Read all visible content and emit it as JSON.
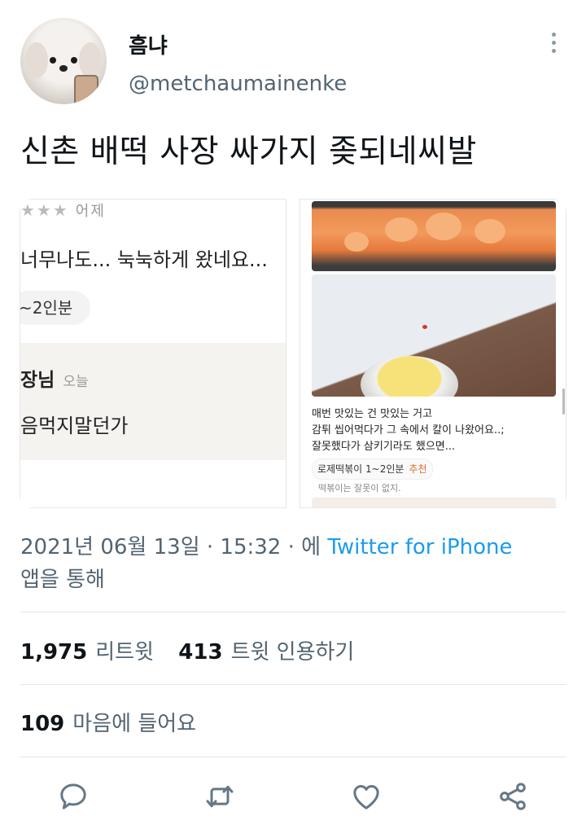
{
  "author": {
    "display_name": "흠냐",
    "handle": "@metchaumainenke"
  },
  "tweet": {
    "text": "신촌 배떡 사장 싸가지 좆되네씨발"
  },
  "media": {
    "left_image": {
      "rating_tail": "어제",
      "review_text": "너무나도... 눅눅하게 왔네요...",
      "pill": "~2인분",
      "owner_label": "장님",
      "owner_time": "오늘",
      "owner_reply": "음먹지말던가"
    },
    "right_image": {
      "line1": "매번 맛있는 건 맛있는 거고",
      "line2": "감튀 씹어먹다가 그 속에서 칼이 나왔어요..;",
      "line3": "잘못했다가 삼키기라도 했으면...",
      "tag": "로제떡볶이 1~2인분",
      "tag_badge": "추천",
      "sub": "떡볶이는 잘못이 없지."
    }
  },
  "meta": {
    "datetime": "2021년 06월 13일 · 15:32 · 에",
    "source": "Twitter for iPhone",
    "via": "앱을 통해"
  },
  "stats": {
    "retweets_count": "1,975",
    "retweets_label": "리트윗",
    "quotes_count": "413",
    "quotes_label": "트윗 인용하기",
    "likes_count": "109",
    "likes_label": "마음에 들어요"
  },
  "colors": {
    "accent": "#1d9bf0",
    "secondary_text": "#536471",
    "icon": "#657786"
  },
  "icons": [
    "more-icon",
    "reply-icon",
    "retweet-icon",
    "like-icon",
    "share-icon"
  ]
}
